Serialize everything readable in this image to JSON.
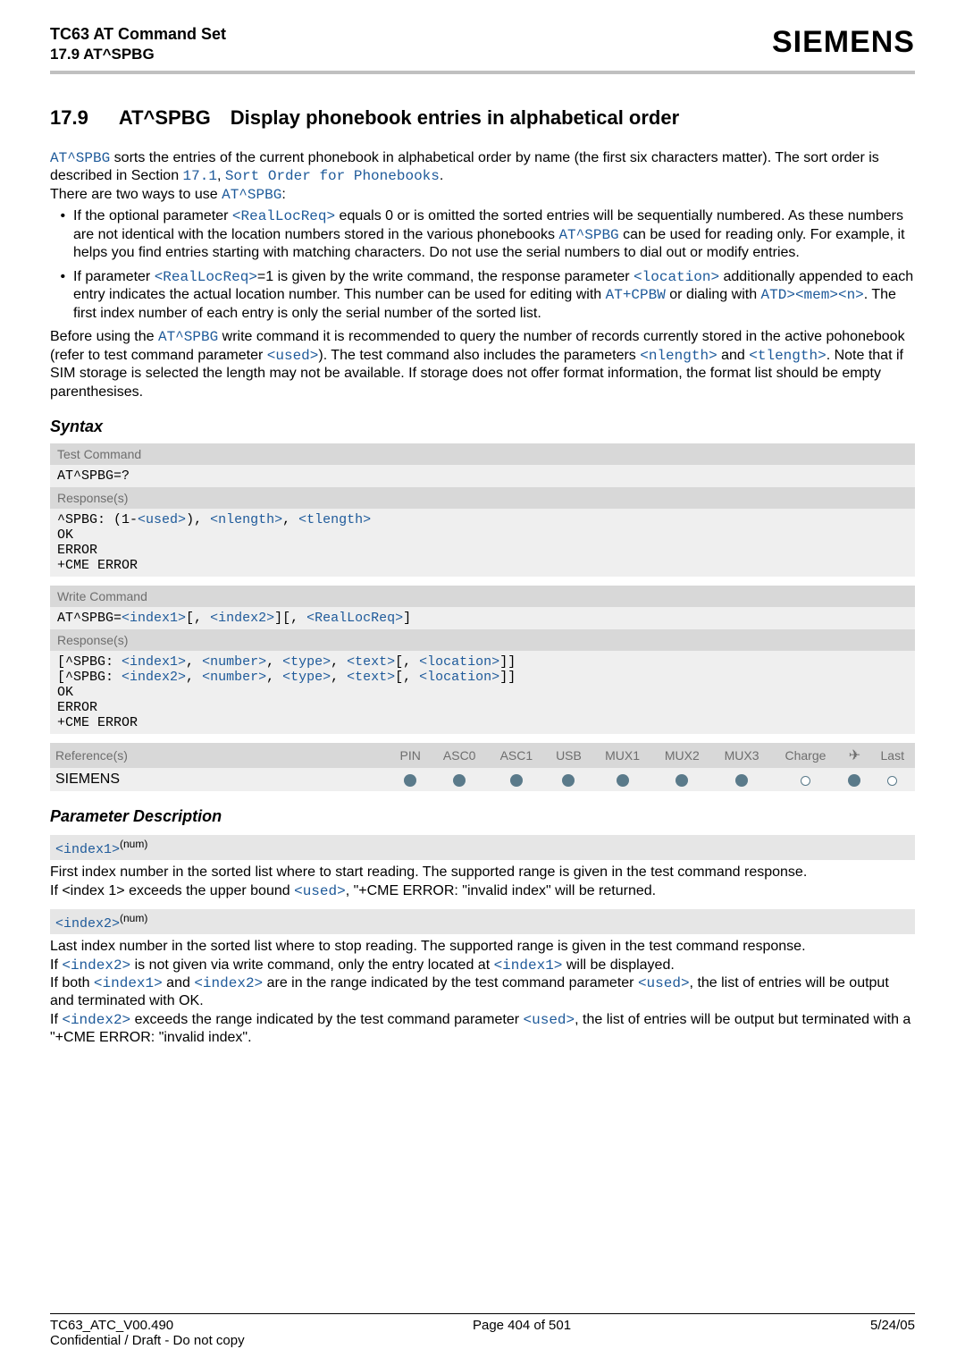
{
  "header": {
    "title": "TC63 AT Command Set",
    "subtitle": "17.9 AT^SPBG",
    "brand": "SIEMENS"
  },
  "section": {
    "number": "17.9",
    "title": "AT^SPBG Display phonebook entries in alphabetical order"
  },
  "intro": {
    "cmd": "AT^SPBG",
    "p1a": " sorts the entries of the current phonebook in alphabetical order by name (the first six characters matter). The sort order is described in Section ",
    "secref": "17.1",
    "sep": ", ",
    "secttl": "Sort Order for Phonebooks",
    "p1b": ".",
    "p2a": "There are two ways to use ",
    "p2cmd": "AT^SPBG",
    "p2b": ":"
  },
  "bullets": {
    "b1a": "If the optional parameter ",
    "b1p": "<RealLocReq>",
    "b1b": " equals 0 or is omitted the sorted entries will be sequentially numbered. As these numbers are not identical with the location numbers stored in the various phonebooks ",
    "b1c": "AT^SPBG",
    "b1d": " can be used for reading only. For example, it helps you find entries starting with matching characters. Do not use the serial numbers to dial out or modify entries.",
    "b2a": "If parameter ",
    "b2p1": "<RealLocReq>",
    "b2b": "=1 is given by the write command, the response parameter ",
    "b2p2": "<location>",
    "b2c": " additionally appended to each entry indicates the actual location number. This number can be used for editing with ",
    "b2cmd1": "AT+CPBW",
    "b2d": " or dialing with ",
    "b2cmd2": "ATD><mem><n>",
    "b2e": ". The first index number of each entry is only the serial number of the sorted list."
  },
  "after": {
    "a1": "Before using the ",
    "a1cmd": "AT^SPBG",
    "a2": " write command it is recommended to query the number of records currently stored in the active pohonebook (refer to test command parameter ",
    "used": "<used>",
    "a3": "). The test command also includes the parameters ",
    "nlen": "<nlength>",
    "a4": " and ",
    "tlen": "<tlength>",
    "a5": ". Note that if SIM storage is selected the length may not be available. If storage does not offer format information, the format list should be empty parenthesises."
  },
  "syntaxHeader": "Syntax",
  "syntax": {
    "testLabel": "Test Command",
    "testCmd": "AT^SPBG=?",
    "respLabel": "Response(s)",
    "testResp": {
      "r1a": "^SPBG: ",
      "r1o": "(",
      "r1n": "1-",
      "used": "<used>",
      "r1c": ")",
      "sep": ", ",
      "nlen": "<nlength>",
      "tlen": "<tlength>",
      "ok": "OK",
      "err": "ERROR",
      "cme": "+CME ERROR"
    },
    "writeLabel": "Write Command",
    "writeCmd": {
      "pre": "AT^SPBG=",
      "idx1": "<index1>",
      "lb1": "[",
      "sep": ", ",
      "idx2": "<index2>",
      "rb1": "]",
      "lb2": "[",
      "rlr": "<RealLocReq>",
      "rb2": "]"
    },
    "writeResp": {
      "lb": "[",
      "pre": "^SPBG: ",
      "idx1": "<index1>",
      "sep": ", ",
      "num": "<number>",
      "type": "<type>",
      "text": "<text>",
      "ilb": "[",
      "loc": "<location>",
      "irb": "]",
      "rb": "]",
      "idx2": "<index2>",
      "ok": "OK",
      "err": "ERROR",
      "cme": "+CME ERROR"
    }
  },
  "refTable": {
    "h0": "Reference(s)",
    "c1": "PIN",
    "c2": "ASC0",
    "c3": "ASC1",
    "c4": "USB",
    "c5": "MUX1",
    "c6": "MUX2",
    "c7": "MUX3",
    "c8": "Charge",
    "c9": "✈",
    "c10": "Last",
    "row": "SIEMENS"
  },
  "parDescHeader": "Parameter Description",
  "params": {
    "idx1": {
      "name": "<index1>",
      "sup": "(num)"
    },
    "idx1txt": {
      "t1": "First index number in the sorted list where to start reading. The supported range is given in the test command response.",
      "t2a": "If <index 1> exceeds the upper bound ",
      "used": "<used>",
      "t2b": ", \"+CME ERROR: \"invalid index\" will be returned."
    },
    "idx2": {
      "name": "<index2>",
      "sup": "(num)"
    },
    "idx2txt": {
      "t1": "Last index number in the sorted list where to stop reading. The supported range is given in the test command response.",
      "t2a": "If ",
      "i2": "<index2>",
      "t2b": " is not given via write command, only the entry located at ",
      "i1": "<index1>",
      "t2c": " will be displayed.",
      "t3a": "If both ",
      "t3b": " and ",
      "t3c": " are in the range indicated by the test command parameter ",
      "t3d": ", the list of entries will be output and terminated with OK.",
      "t4a": "If ",
      "t4b": " exceeds the range indicated by the test command parameter ",
      "t4c": ", the list of entries will be output but terminated with a \"+CME ERROR: \"invalid index\".",
      "used": "<used>"
    }
  },
  "footer": {
    "left": "TC63_ATC_V00.490",
    "center": "Page 404 of 501",
    "right": "5/24/05",
    "conf": "Confidential / Draft - Do not copy"
  }
}
